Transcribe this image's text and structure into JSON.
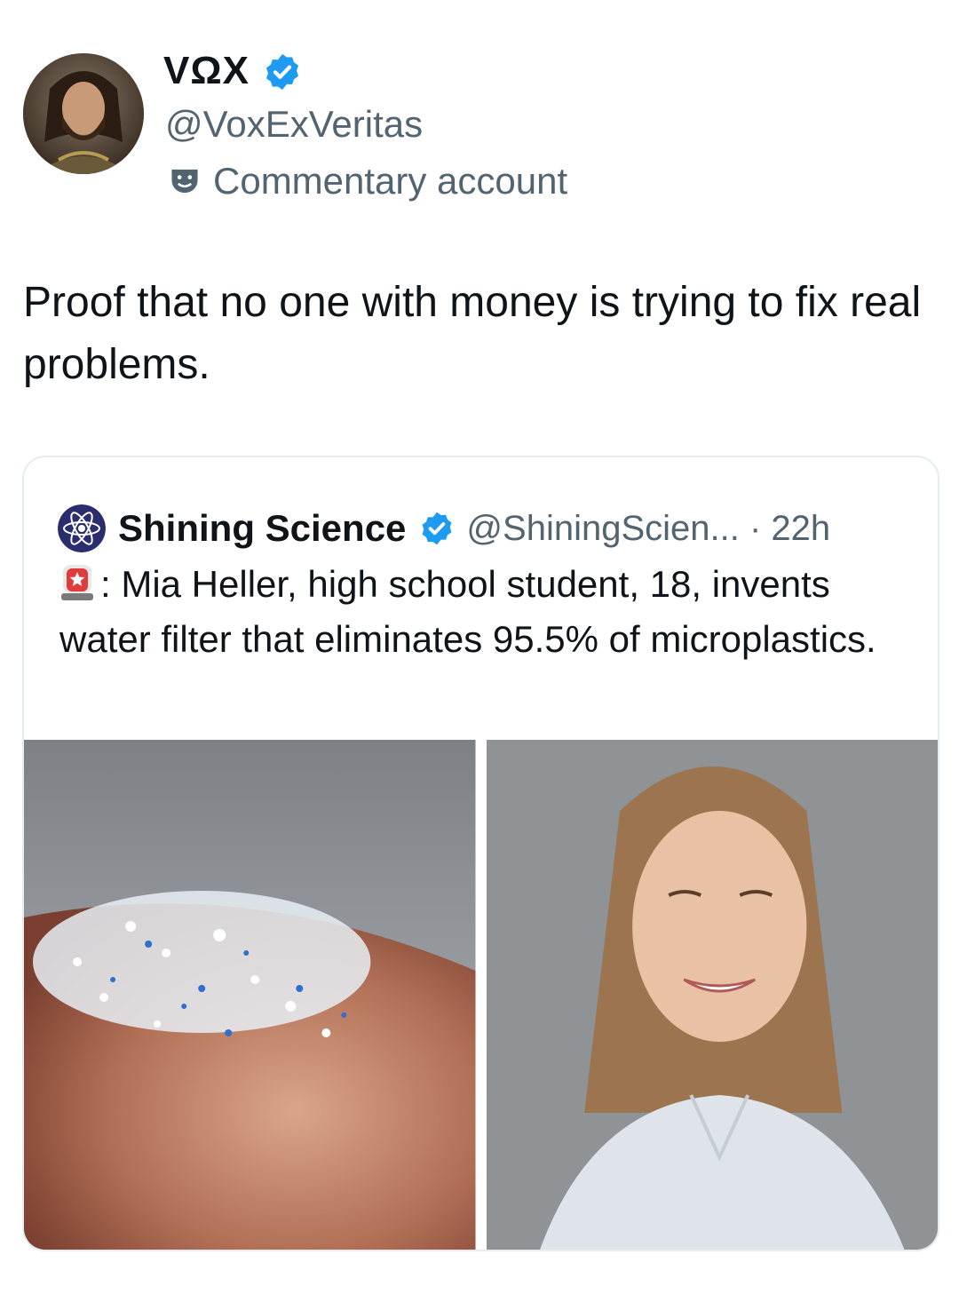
{
  "author": {
    "display_name": "VΩX",
    "handle": "@VoxExVeritas",
    "badge_label": "Commentary account",
    "verified": true
  },
  "tweet": {
    "text": "Proof that no one with money is trying to fix real problems."
  },
  "quoted_tweet": {
    "display_name": "Shining Science",
    "handle": "@ShiningScien...",
    "separator": " · ",
    "time": "22h",
    "verified": true,
    "emoji": "siren-emoji",
    "text": ": Mia Heller, high school student, 18, invents water filter that eliminates 95.5% of microplastics."
  },
  "colors": {
    "verified_blue": "#1d9bf0",
    "secondary_text": "#536471",
    "primary_text": "#0f1419"
  }
}
